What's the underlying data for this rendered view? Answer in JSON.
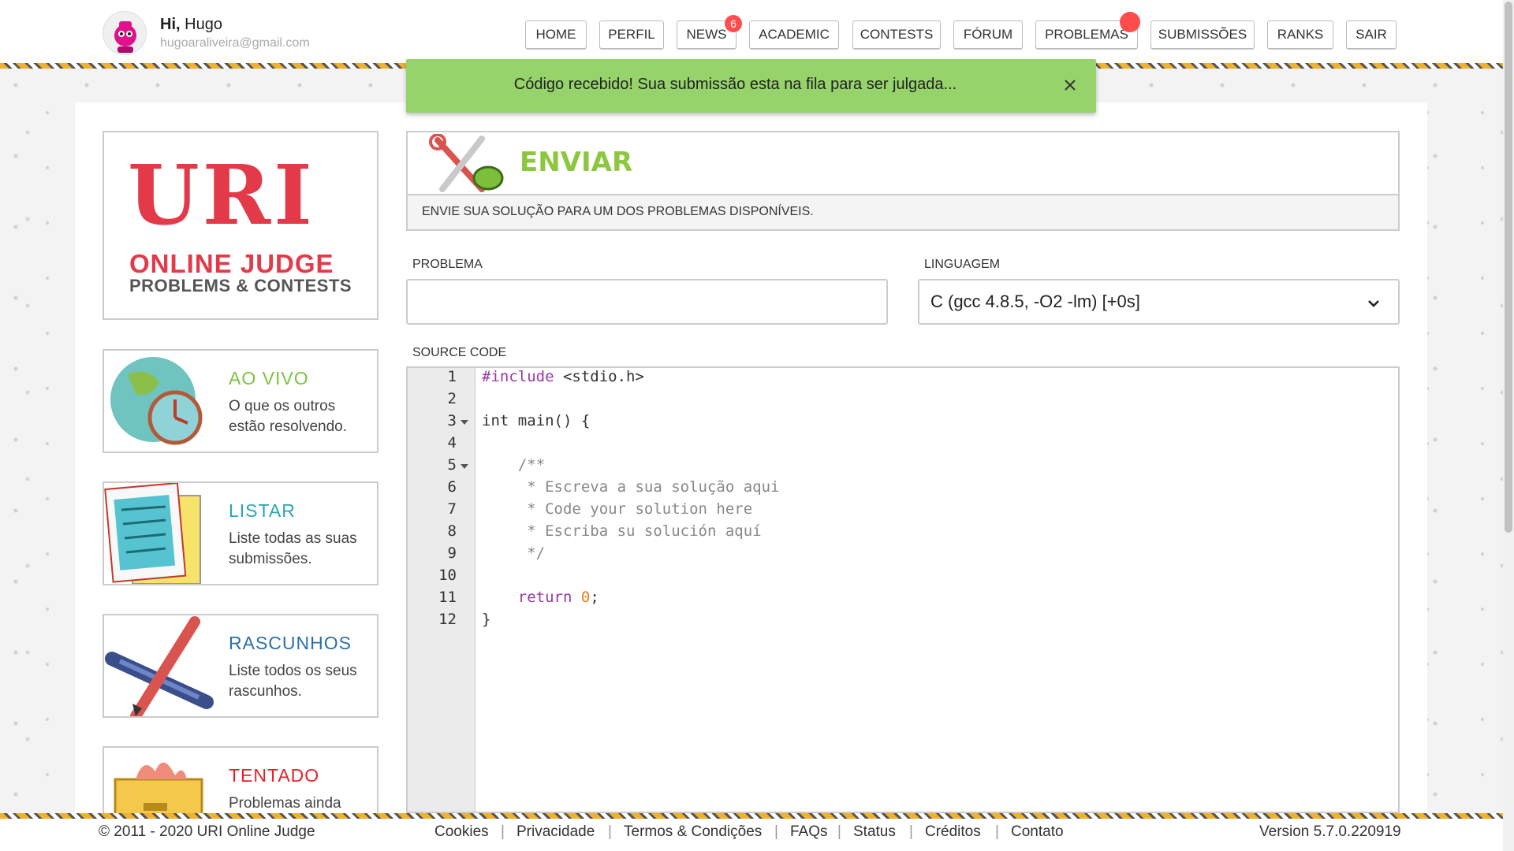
{
  "user": {
    "greeting_bold": "Hi,",
    "name": "Hugo",
    "email": "hugoaraliveira@gmail.com"
  },
  "nav": {
    "home": "HOME",
    "perfil": "PERFIL",
    "news": "NEWS",
    "news_badge": "6",
    "academic": "ACADEMIC",
    "contests": "CONTESTS",
    "forum": "FÓRUM",
    "problemas": "PROBLEMAS",
    "submissoes": "SUBMISSÕES",
    "ranks": "RANKS",
    "sair": "SAIR"
  },
  "toast": {
    "message": "Código recebido! Sua submissão esta na fila para ser julgada..."
  },
  "logo": {
    "uri": "URI",
    "online_judge": "ONLINE JUDGE",
    "problems_contests": "PROBLEMS & CONTESTS"
  },
  "sidebar": [
    {
      "title": "AO VIVO",
      "desc": "O que os outros estão resolvendo.",
      "color": "#7dc242"
    },
    {
      "title": "LISTAR",
      "desc": "Liste todas as suas submissões.",
      "color": "#2aa6b8"
    },
    {
      "title": "RASCUNHOS",
      "desc": "Liste todos os seus rascunhos.",
      "color": "#2b6fa8"
    },
    {
      "title": "TENTADO",
      "desc": "Problemas ainda",
      "color": "#e8202a"
    }
  ],
  "enviar": {
    "title": "ENVIAR",
    "subtitle": "ENVIE SUA SOLUÇÃO PARA UM DOS PROBLEMAS DISPONÍVEIS."
  },
  "form": {
    "problema_label": "PROBLEMA",
    "problema_value": "",
    "linguagem_label": "LINGUAGEM",
    "linguagem_value": "C (gcc 4.8.5, -O2 -lm) [+0s]",
    "source_label": "SOURCE CODE"
  },
  "editor": {
    "line_numbers": [
      "1",
      "2",
      "3",
      "4",
      "5",
      "6",
      "7",
      "8",
      "9",
      "10",
      "11",
      "12"
    ],
    "lines": [
      "#include <stdio.h>",
      "",
      "int main() {",
      "",
      "    /**",
      "     * Escreva a sua solução aqui",
      "     * Code your solution here",
      "     * Escriba su solución aquí",
      "     */",
      "",
      "    return 0;",
      "}"
    ]
  },
  "footer": {
    "copyright": "© 2011 - 2020 URI Online Judge",
    "links": [
      "Cookies",
      "Privacidade",
      "Termos & Condições",
      "FAQs",
      "Status",
      "Créditos",
      "Contato"
    ],
    "separator": "|",
    "version": "Version 5.7.0.220919"
  },
  "colors": {
    "accent_green": "#8dc63f",
    "toast_bg": "#96d36a",
    "badge_red": "#ff4d4d",
    "logo_red": "#e33a4a"
  }
}
